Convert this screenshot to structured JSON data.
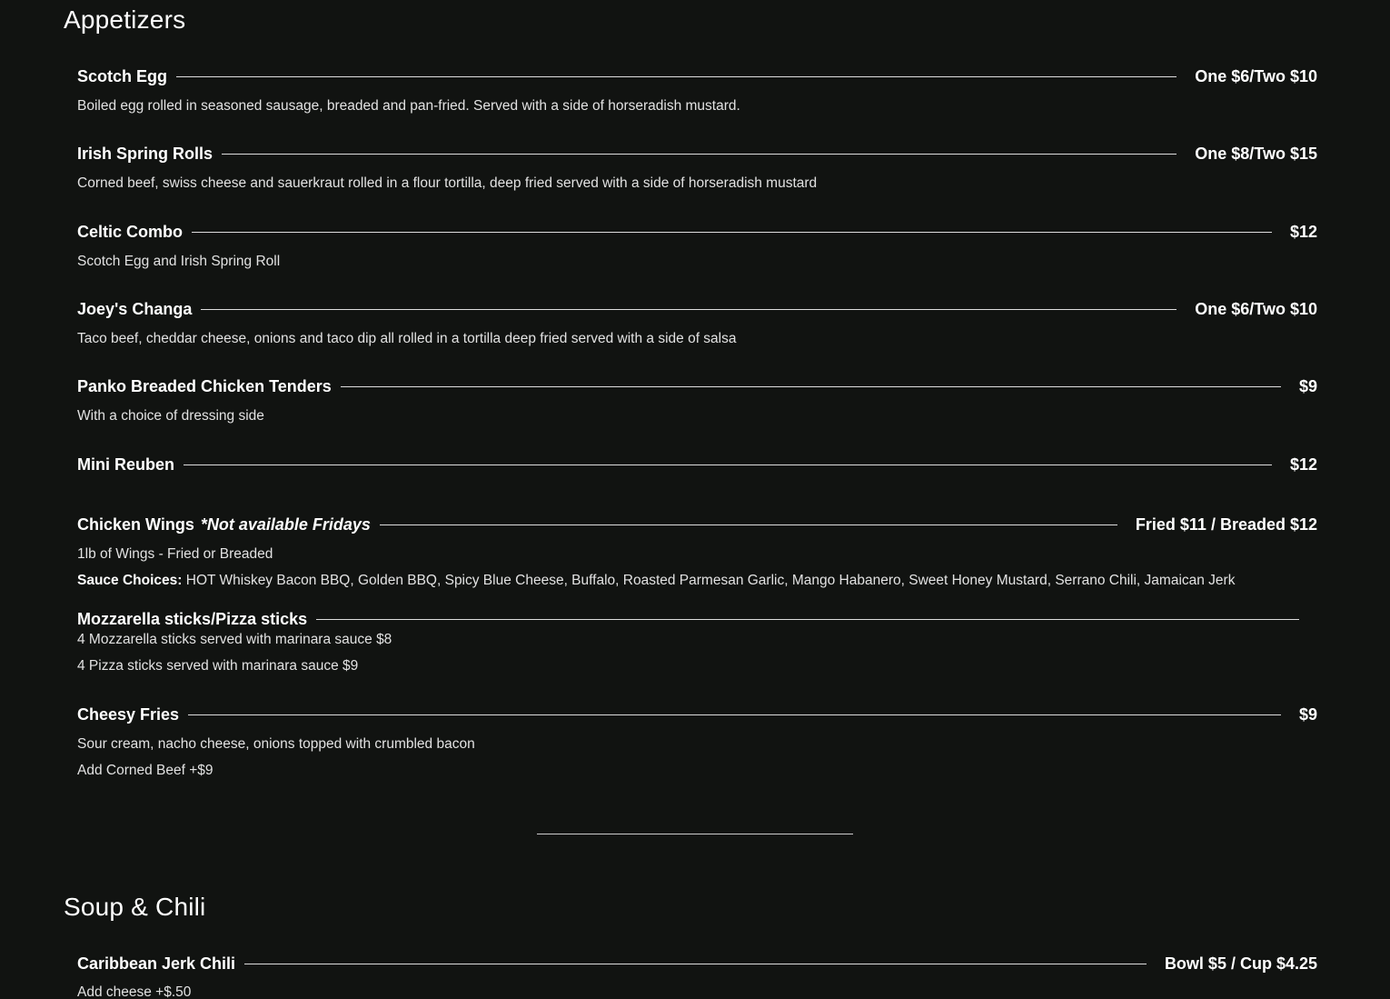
{
  "sections": [
    {
      "title": "Appetizers",
      "items": [
        {
          "name": "Scotch Egg",
          "price": "One $6/Two $10",
          "description": "Boiled egg rolled in seasoned sausage, breaded and pan-fried. Served with a side of horseradish mustard."
        },
        {
          "name": "Irish Spring Rolls",
          "price": "One $8/Two $15",
          "description": "Corned beef, swiss cheese and sauerkraut rolled in a flour tortilla, deep fried served with a side of horseradish mustard"
        },
        {
          "name": "Celtic Combo",
          "price": "$12",
          "description": "Scotch Egg and Irish Spring Roll"
        },
        {
          "name": "Joey's Changa",
          "price": "One $6/Two $10",
          "description": "Taco beef, cheddar cheese, onions and taco dip all rolled in a tortilla deep fried served with a side of salsa"
        },
        {
          "name": "Panko Breaded Chicken Tenders",
          "price": "$9",
          "description": "With a choice of dressing side"
        },
        {
          "name": "Mini Reuben",
          "price": "$12"
        },
        {
          "name": "Chicken Wings",
          "note": "*Not available Fridays",
          "price": "Fried $11 / Breaded $12",
          "description": "1lb of Wings - Fried or Breaded",
          "sauce_label": "Sauce Choices:",
          "sauce_list": "HOT Whiskey Bacon BBQ, Golden BBQ, Spicy Blue Cheese, Buffalo, Roasted Parmesan Garlic, Mango Habanero, Sweet Honey Mustard, Serrano Chili, Jamaican Jerk"
        },
        {
          "name": "Mozzarella sticks/Pizza sticks",
          "description_lines": [
            "4 Mozzarella sticks served with marinara sauce $8",
            "4 Pizza sticks served with marinara sauce $9"
          ]
        },
        {
          "name": "Cheesy Fries",
          "price": "$9",
          "description_lines": [
            "Sour cream, nacho cheese, onions topped with crumbled bacon",
            "Add Corned Beef +$9"
          ]
        }
      ]
    },
    {
      "title": "Soup & Chili",
      "items": [
        {
          "name": "Caribbean Jerk Chili",
          "price": "Bowl $5 / Cup $4.25",
          "description": "Add cheese +$.50"
        }
      ]
    }
  ]
}
